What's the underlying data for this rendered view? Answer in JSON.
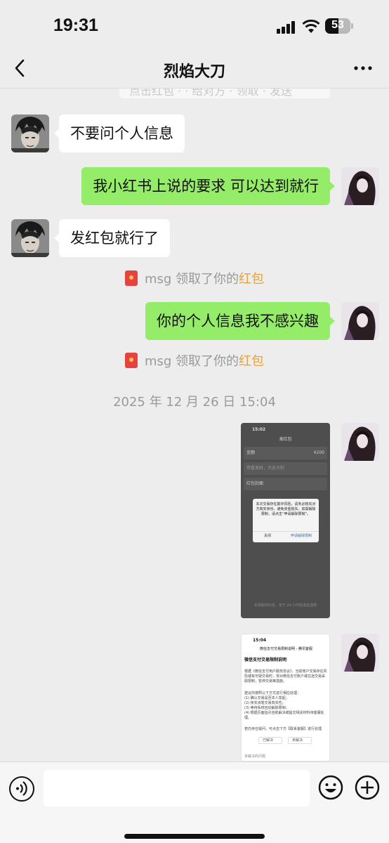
{
  "status_bar": {
    "time": "19:31",
    "battery": "53",
    "battery_level": 0.53
  },
  "nav": {
    "title": "烈焰大刀"
  },
  "chat": {
    "clipped_top_text": "点击红包 · · 给对方 · 领取 · 发送",
    "messages": [
      {
        "side": "in",
        "text": "不要问个人信息"
      },
      {
        "side": "out",
        "text": "我小红书上说的要求 可以达到就行"
      },
      {
        "side": "in",
        "text": "发红包就行了"
      },
      {
        "type": "system",
        "prefix": "msg 领取了你的",
        "highlight": "红包"
      },
      {
        "side": "out",
        "text": "你的个人信息我不感兴趣"
      },
      {
        "type": "system",
        "prefix": "msg 领取了你的",
        "highlight": "红包"
      },
      {
        "type": "timestamp",
        "text": "2025 年 12 月 26 日 15:04"
      }
    ],
    "image1": {
      "time": "15:02",
      "title": "发红包",
      "amount_label": "金额",
      "amount_value": "¥200",
      "greeting_placeholder": "恭喜发财，大吉大利",
      "cover_label": "红包封面",
      "dialog_text": "本次交易存在欺诈风险，请务必核实对方真实身份，避免资金损失。如需解除限制，请点击“申请解除限制”。",
      "dialog_close": "关闭",
      "dialog_apply": "申请解除限制",
      "footer": "未领取的红包，将于 24 小时后发起退款"
    },
    "image2": {
      "time": "15:04",
      "header": "微信支付交易限制说明 - 腾讯客服",
      "title": "微信支付交易限制说明",
      "para1": "根据《微信支付用户服务协议》，当前账户交易存在风险或有可疑交易时，将对微信支付账户或在途交易采取限制，暂停交易等措施。",
      "para2": "建议你按照以下方式进行相应处理：",
      "items": [
        "(1) 确认交易是否本人发起；",
        "(2) 核实该笔交易真实性；",
        "(3) 等待系统自动解除限制；",
        "(4) 根据页面指引自助解决或提交相关材料待客服处理。"
      ],
      "para3": "若仍存在疑问，可点击下方【联系客服】进行处理",
      "btn_solved": "已解决",
      "btn_unsolved": "未解决",
      "footer": "未解决的问题"
    }
  }
}
